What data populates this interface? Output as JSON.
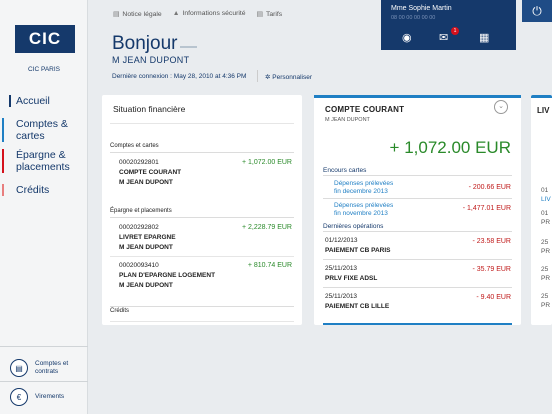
{
  "brand": {
    "logo_text": "CIC",
    "name": "CIC PARIS"
  },
  "nav": [
    {
      "label": "Accueil"
    },
    {
      "label": "Comptes & cartes"
    },
    {
      "label": "Épargne & placements"
    },
    {
      "label": "Crédits"
    }
  ],
  "sidebar_buttons": {
    "comptes": "Comptes et contrats",
    "virements": "Virements"
  },
  "toplinks": {
    "legal": "Notice légale",
    "security": "Informations sécurité",
    "tarifs": "Tarifs"
  },
  "user": {
    "name": "Mme Sophie Martin",
    "id": "08 00 00 00 00 00",
    "badge": "1"
  },
  "greeting": {
    "title": "Bonjour",
    "name": "M JEAN DUPONT",
    "last_connection": "Dernière connexion : May 28, 2010 at 4:36 PM",
    "customize": "Personnaliser"
  },
  "situation": {
    "title": "Situation financière",
    "sections": {
      "comptes": "Comptes et cartes",
      "epargne": "Épargne et placements",
      "credits": "Crédits"
    },
    "accounts": [
      {
        "number": "00020292801",
        "name": "COMPTE COURANT",
        "holder": "M JEAN DUPONT",
        "amount": "+ 1,072.00 EUR"
      },
      {
        "number": "00020292802",
        "name": "LIVRET EPARGNE",
        "holder": "M JEAN DUPONT",
        "amount": "+ 2,228.79 EUR"
      },
      {
        "number": "00020093410",
        "name": "PLAN D'EPARGNE LOGEMENT",
        "holder": "M JEAN DUPONT",
        "amount": "+ 810.74 EUR"
      }
    ]
  },
  "compte": {
    "title": "COMPTE COURANT",
    "holder": "M JEAN DUPONT",
    "balance": "+ 1,072.00 EUR",
    "encours_title": "Encours cartes",
    "encours": [
      {
        "label1": "Dépenses prélevées",
        "label2": "fin decembre 2013",
        "amount": "- 200.66 EUR"
      },
      {
        "label1": "Dépenses prélevées",
        "label2": "fin novembre 2013",
        "amount": "- 1,477.01 EUR"
      }
    ],
    "ops_title": "Dernières opérations",
    "ops": [
      {
        "date": "01/12/2013",
        "label": "PAIEMENT CB PARIS",
        "amount": "- 23.58 EUR"
      },
      {
        "date": "25/11/2013",
        "label": "PRLV FIXE ADSL",
        "amount": "- 35.79 EUR"
      },
      {
        "date": "25/11/2013",
        "label": "PAIEMENT CB LILLE",
        "amount": "- 9.40 EUR"
      }
    ]
  },
  "card3": {
    "title": "LIV",
    "lines": [
      "01",
      "LIV",
      "01",
      "PR",
      "25",
      "PR",
      "25",
      "PR",
      "25",
      "PR"
    ]
  }
}
